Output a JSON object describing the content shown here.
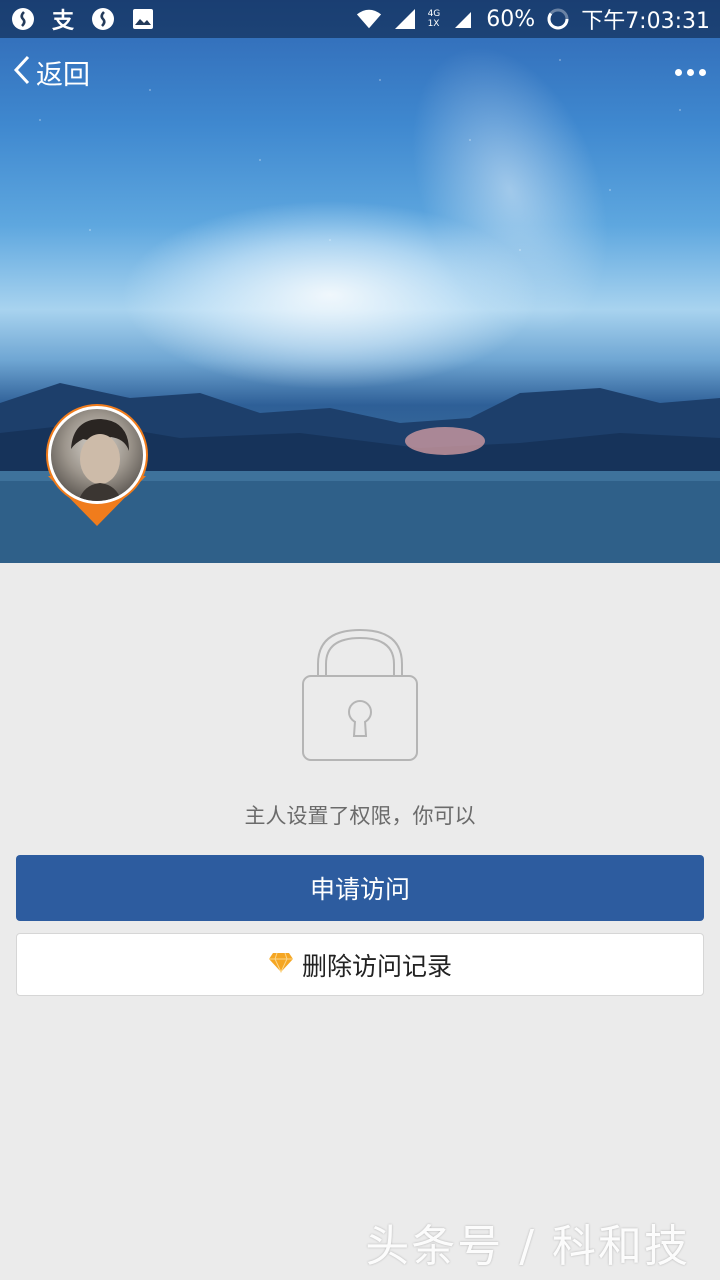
{
  "status_bar": {
    "battery_percent": "60%",
    "time": "下午7:03:31",
    "left_text_icon": "支",
    "network_label_top": "4G",
    "network_label_bottom": "1X"
  },
  "nav": {
    "back_label": "返回"
  },
  "permission": {
    "message": "主人设置了权限，你可以"
  },
  "actions": {
    "request_access_label": "申请访问",
    "delete_records_label": "删除访问记录"
  },
  "watermark": "头条号 / 科和技",
  "colors": {
    "primary_button": "#2d5c9f",
    "page_background": "#ebebeb",
    "avatar_pin": "#f07c1c",
    "diamond": "#f5a623"
  }
}
